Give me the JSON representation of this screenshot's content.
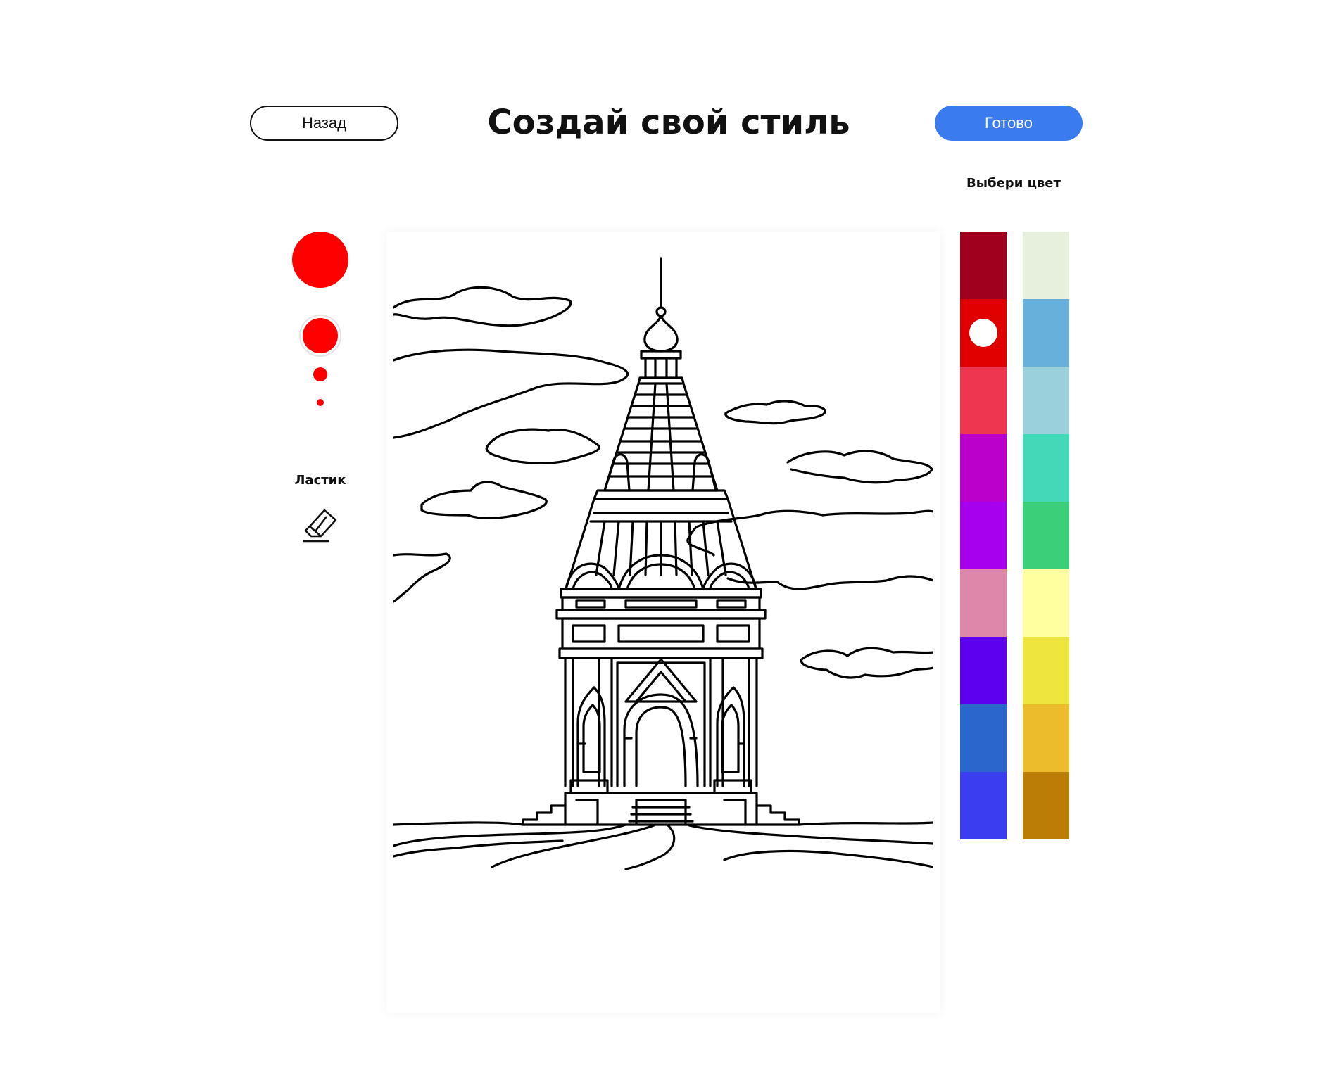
{
  "header": {
    "title": "Создай свой стиль",
    "back_label": "Назад",
    "done_label": "Готово"
  },
  "tools": {
    "brush_color": "#ff0000",
    "brush_sizes": [
      "xl",
      "l",
      "m",
      "s"
    ],
    "selected_brush": "l",
    "eraser_label": "Ластик",
    "eraser_icon": "eraser-icon"
  },
  "palette": {
    "label": "Выбери цвет",
    "selected": "#e00000",
    "left": [
      "#a0001e",
      "#e00000",
      "#ef3651",
      "#bb00cc",
      "#a600ee",
      "#dd88aa",
      "#5d00ee",
      "#2a66cc",
      "#3b3ef0"
    ],
    "right": [
      "#e6f0dc",
      "#66b0dc",
      "#99d0dc",
      "#44d8b8",
      "#3ccf7a",
      "#ffffa0",
      "#eee63c",
      "#ecbc2c",
      "#ba7e06"
    ]
  },
  "canvas": {
    "drawing": "tower-chapel-coloring-page"
  }
}
